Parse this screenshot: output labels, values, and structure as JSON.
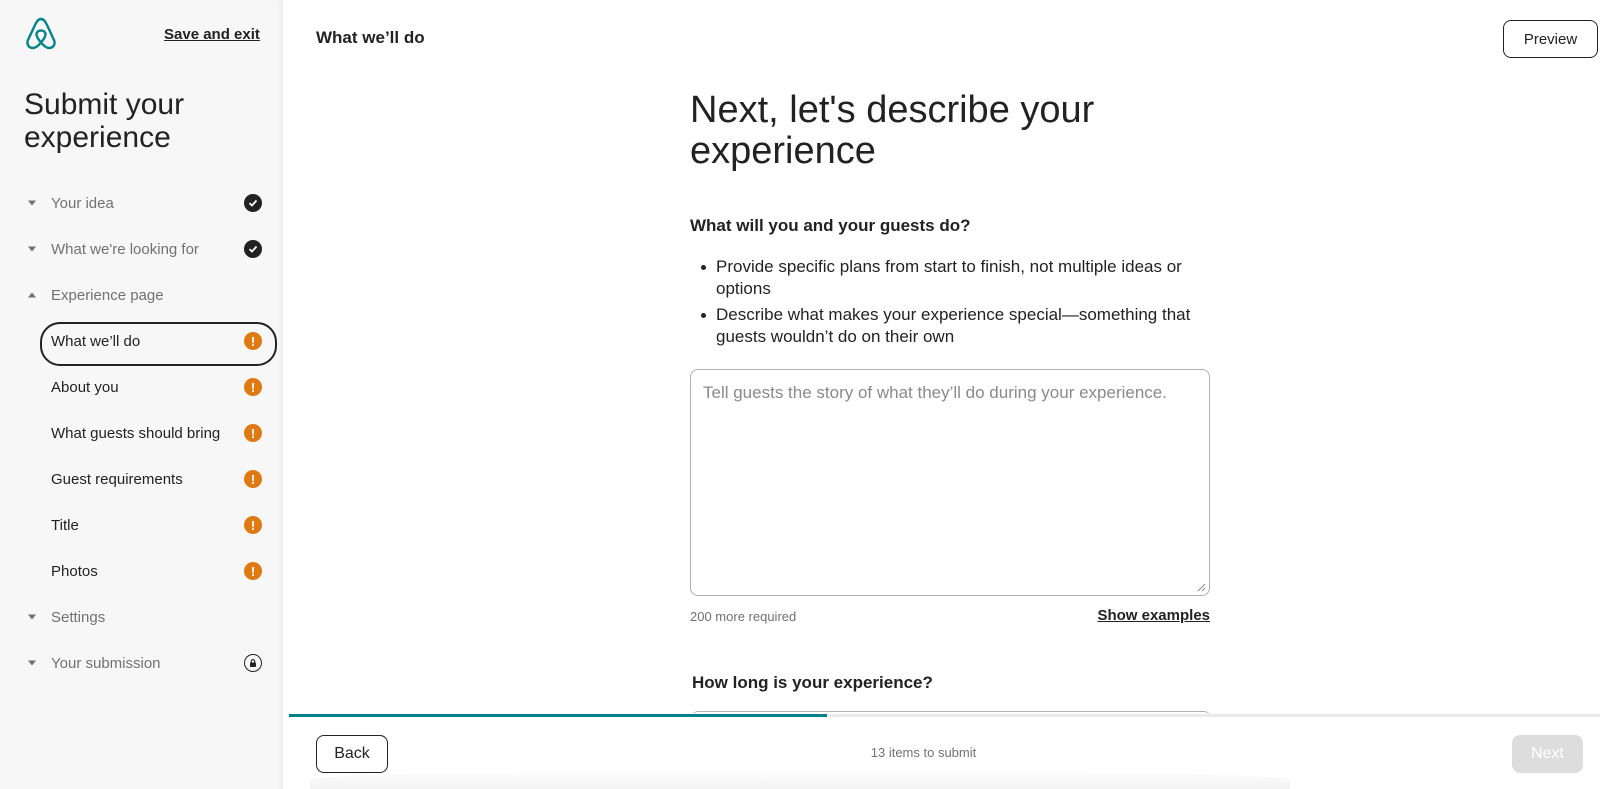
{
  "brand": {
    "logo_icon": "airbnb-belo-logo",
    "accent_color": "#008489"
  },
  "sidebar": {
    "save_exit_label": "Save and exit",
    "title": "Submit your experience",
    "items": [
      {
        "label": "Your idea",
        "caret": "down",
        "status": "complete"
      },
      {
        "label": "What we're looking for",
        "caret": "down",
        "status": "complete"
      },
      {
        "label": "Experience page",
        "caret": "up",
        "status": ""
      },
      {
        "label": "What we’ll do",
        "sub": true,
        "active": true,
        "status": "incomplete"
      },
      {
        "label": "About you",
        "sub": true,
        "status": "incomplete"
      },
      {
        "label": "What guests should bring",
        "sub": true,
        "status": "incomplete"
      },
      {
        "label": "Guest requirements",
        "sub": true,
        "status": "incomplete"
      },
      {
        "label": "Title",
        "sub": true,
        "status": "incomplete"
      },
      {
        "label": "Photos",
        "sub": true,
        "status": "incomplete"
      },
      {
        "label": "Settings",
        "caret": "down",
        "status": ""
      },
      {
        "label": "Your submission",
        "caret": "down",
        "status": "locked"
      }
    ],
    "status_colors": {
      "complete": "#222222",
      "incomplete": "#e07912"
    }
  },
  "header": {
    "title": "What we’ll do",
    "preview_label": "Preview"
  },
  "main": {
    "heading": "Next, let's describe your experience",
    "question": "What will you and your guests do?",
    "tips": [
      "Provide specific plans from start to finish, not multiple ideas or options",
      "Describe what makes your experience special—something that guests wouldn’t do on their own"
    ],
    "description_value": "",
    "description_placeholder": "Tell guests the story of what they’ll do during your experience.",
    "char_count": "200 more required",
    "show_examples_label": "Show examples",
    "question2": "How long is your experience?"
  },
  "footer": {
    "back_label": "Back",
    "items_to_submit": "13 items to submit",
    "next_label": "Next",
    "progress_percent": 41
  }
}
